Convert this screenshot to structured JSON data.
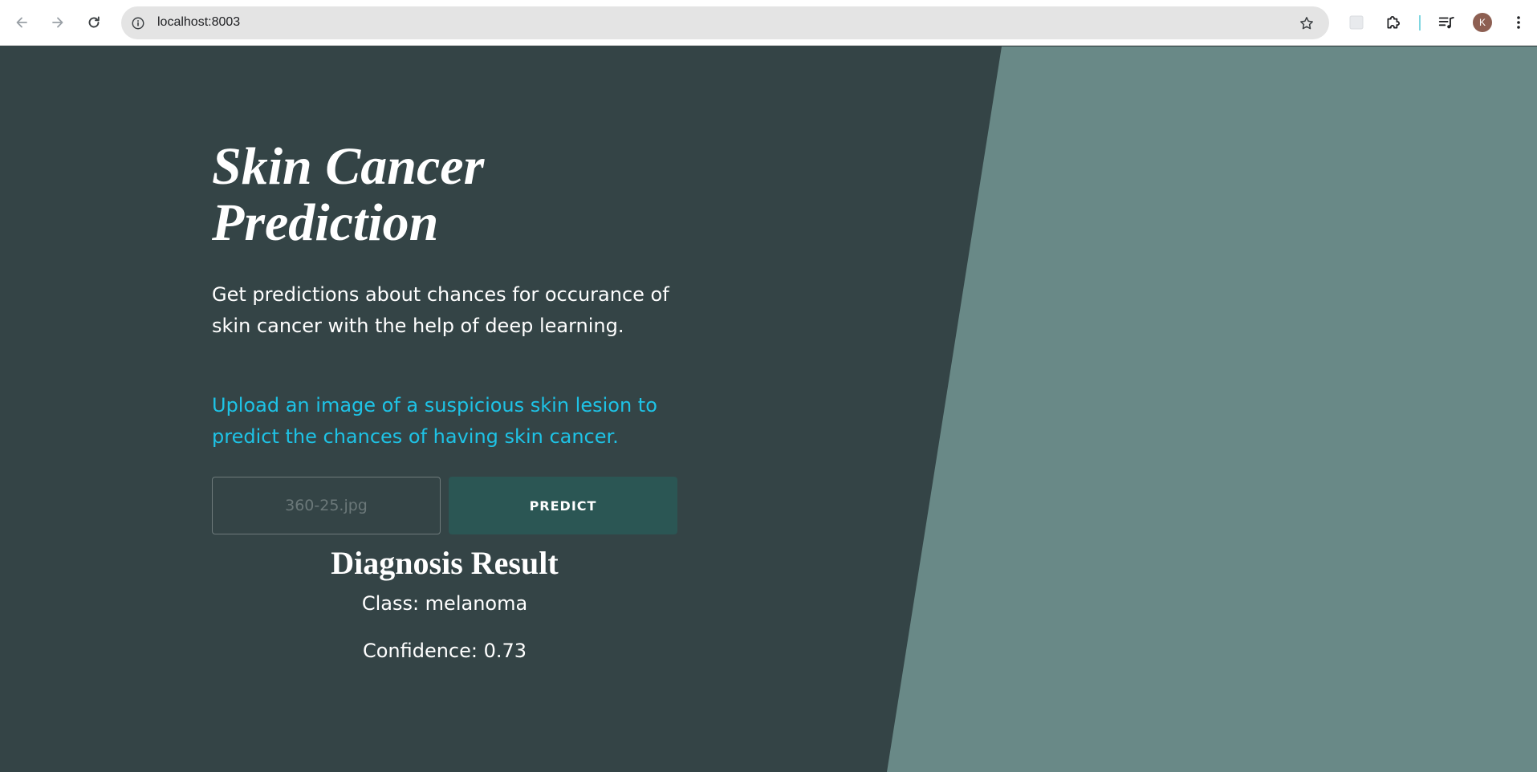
{
  "browser": {
    "url": "localhost:8003",
    "profile_initial": "K",
    "icons": {
      "back": "arrow-left-icon",
      "forward": "arrow-right-icon",
      "reload": "reload-icon",
      "site_info": "info-icon",
      "bookmark": "star-icon",
      "extension_placeholder": "extension-tile-icon",
      "extensions": "puzzle-icon",
      "media": "media-queue-icon",
      "menu": "kebab-menu-icon"
    }
  },
  "page": {
    "title_line1": "Skin Cancer",
    "title_line2": "Prediction",
    "subtitle": "Get predictions about chances for occurance of skin cancer with the help of deep learning.",
    "upload_prompt": "Upload an image of a suspicious skin lesion to predict the chances of having skin cancer.",
    "file_name": "360-25.jpg",
    "predict_label": "PREDICT",
    "result_heading": "Diagnosis Result",
    "result_class": "Class: melanoma",
    "result_confidence": "Confidence: 0.73"
  },
  "colors": {
    "dark_bg": "#344446",
    "light_panel": "#698987",
    "accent_text": "#1ec3e6",
    "button_bg": "#2b5654"
  }
}
